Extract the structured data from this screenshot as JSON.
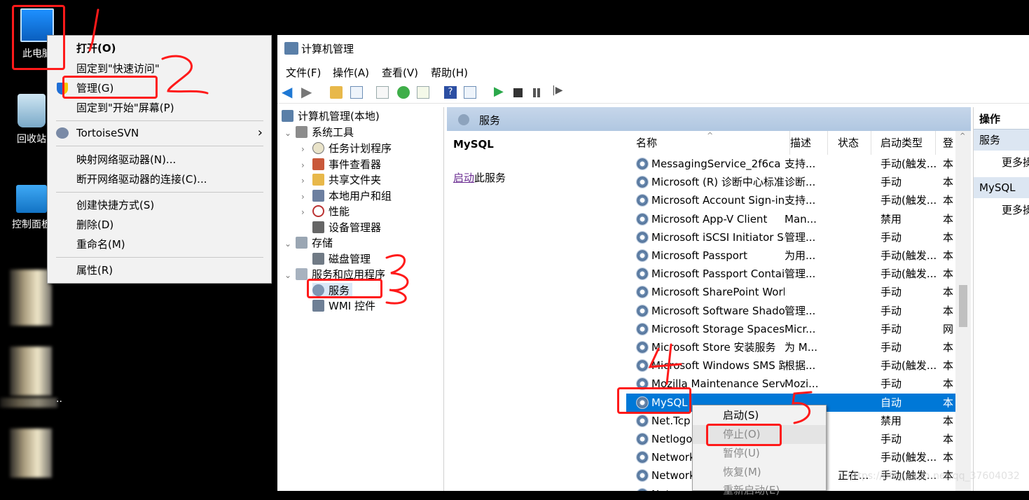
{
  "desktop": {
    "icons": [
      {
        "label": "此电脑"
      },
      {
        "label": "回收站"
      },
      {
        "label": "控制面板"
      }
    ],
    "stray_text": ".."
  },
  "context_menu": {
    "items": [
      {
        "label": "打开(O)"
      },
      {
        "label": "固定到\"快速访问\""
      },
      {
        "label": "管理(G)"
      },
      {
        "label": "固定到\"开始\"屏幕(P)"
      },
      {
        "label": "TortoiseSVN"
      },
      {
        "label": "映射网络驱动器(N)..."
      },
      {
        "label": "断开网络驱动器的连接(C)..."
      },
      {
        "label": "创建快捷方式(S)"
      },
      {
        "label": "删除(D)"
      },
      {
        "label": "重命名(M)"
      },
      {
        "label": "属性(R)"
      }
    ]
  },
  "window": {
    "title": "计算机管理",
    "menu": [
      "文件(F)",
      "操作(A)",
      "查看(V)",
      "帮助(H)"
    ],
    "tree": [
      {
        "label": "计算机管理(本地)"
      },
      {
        "label": "系统工具"
      },
      {
        "label": "任务计划程序"
      },
      {
        "label": "事件查看器"
      },
      {
        "label": "共享文件夹"
      },
      {
        "label": "本地用户和组"
      },
      {
        "label": "性能"
      },
      {
        "label": "设备管理器"
      },
      {
        "label": "存储"
      },
      {
        "label": "磁盘管理"
      },
      {
        "label": "服务和应用程序"
      },
      {
        "label": "服务"
      },
      {
        "label": "WMI 控件"
      }
    ],
    "services_header": "服务",
    "selected_service": "MySQL",
    "start_link": "启动",
    "start_link_suffix": "此服务",
    "columns": [
      "名称",
      "描述",
      "状态",
      "启动类型",
      "登"
    ],
    "rows": [
      {
        "name": "MessagingService_2f6ca",
        "desc": "支持...",
        "status": "",
        "startup": "手动(触发...",
        "logon": "本"
      },
      {
        "name": "Microsoft (R) 诊断中心标准...",
        "desc": "诊断...",
        "status": "",
        "startup": "手动",
        "logon": "本"
      },
      {
        "name": "Microsoft Account Sign-in ...",
        "desc": "支持...",
        "status": "",
        "startup": "手动(触发...",
        "logon": "本"
      },
      {
        "name": "Microsoft App-V Client",
        "desc": "Man...",
        "status": "",
        "startup": "禁用",
        "logon": "本"
      },
      {
        "name": "Microsoft iSCSI Initiator Ser...",
        "desc": "管理...",
        "status": "",
        "startup": "手动",
        "logon": "本"
      },
      {
        "name": "Microsoft Passport",
        "desc": "为用...",
        "status": "",
        "startup": "手动(触发...",
        "logon": "本"
      },
      {
        "name": "Microsoft Passport Container",
        "desc": "管理...",
        "status": "",
        "startup": "手动(触发...",
        "logon": "本"
      },
      {
        "name": "Microsoft SharePoint Work...",
        "desc": "",
        "status": "",
        "startup": "手动",
        "logon": "本"
      },
      {
        "name": "Microsoft Software Shado...",
        "desc": "管理...",
        "status": "",
        "startup": "手动",
        "logon": "本"
      },
      {
        "name": "Microsoft Storage Spaces S...",
        "desc": "Micr...",
        "status": "",
        "startup": "手动",
        "logon": "网"
      },
      {
        "name": "Microsoft Store 安装服务",
        "desc": "为 M...",
        "status": "",
        "startup": "手动",
        "logon": "本"
      },
      {
        "name": "Microsoft Windows SMS 路...",
        "desc": "根据...",
        "status": "",
        "startup": "手动(触发...",
        "logon": "本"
      },
      {
        "name": "Mozilla Maintenance Service",
        "desc": "Mozi...",
        "status": "",
        "startup": "手动",
        "logon": "本"
      },
      {
        "name": "MySQL",
        "desc": "",
        "status": "",
        "startup": "自动",
        "logon": "本"
      },
      {
        "name": "Net.Tcp",
        "desc": "",
        "status": "",
        "startup": "禁用",
        "logon": "本"
      },
      {
        "name": "Netlogo",
        "desc": "",
        "status": "",
        "startup": "手动",
        "logon": "本"
      },
      {
        "name": "Network",
        "desc": "",
        "status": "",
        "startup": "手动(触发...",
        "logon": "本"
      },
      {
        "name": "Network",
        "desc": "",
        "status": "正在...",
        "startup": "手动(触发...",
        "logon": "本"
      },
      {
        "name": "Netwo",
        "desc": "",
        "status": "",
        "startup": "",
        "logon": ""
      }
    ],
    "actions": {
      "header": "操作",
      "sections": [
        {
          "title": "服务",
          "item": "更多操"
        },
        {
          "title": "MySQL",
          "item": "更多操"
        }
      ]
    }
  },
  "service_menu": {
    "items": [
      {
        "label": "启动(S)"
      },
      {
        "label": "停止(O)"
      },
      {
        "label": "暂停(U)"
      },
      {
        "label": "恢复(M)"
      },
      {
        "label": "重新启动(E)"
      }
    ]
  },
  "annotations": [
    "1",
    "2",
    "3",
    "4",
    "5"
  ],
  "watermark": "https://blog.csdn.net/qq_37604032"
}
